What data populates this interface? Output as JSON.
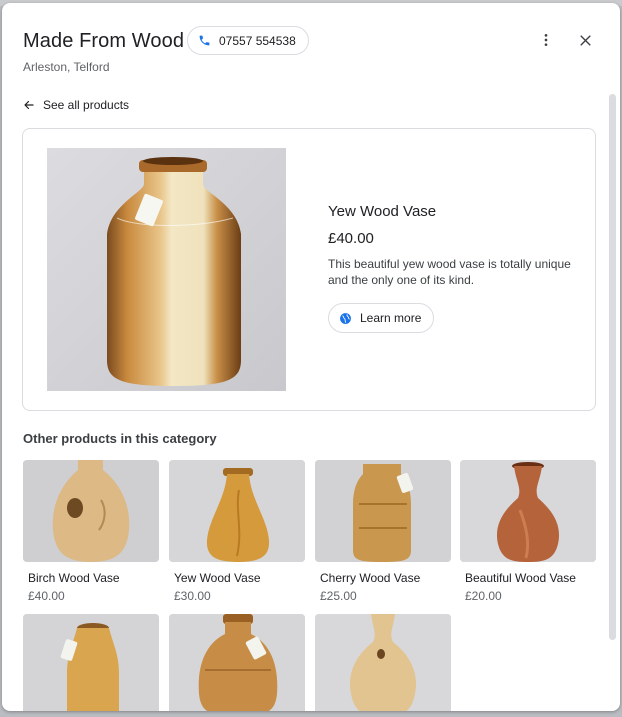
{
  "header": {
    "title": "Made From Wood",
    "phone": "07557 554538",
    "address": "Arleston, Telford",
    "phone_icon": "phone-icon",
    "more_icon": "more-vert-icon",
    "close_icon": "close-icon"
  },
  "nav": {
    "back_label": "See all products",
    "back_icon": "arrow-back-icon"
  },
  "product": {
    "name": "Yew Wood Vase",
    "price": "£40.00",
    "description": "This beautiful yew wood vase is totally unique and the only one of its kind.",
    "learn_more_label": "Learn more",
    "learn_more_icon": "globe-icon"
  },
  "other_products": {
    "heading": "Other products in this category",
    "items": [
      {
        "name": "Birch Wood Vase",
        "price": "£40.00"
      },
      {
        "name": "Yew Wood Vase",
        "price": "£30.00"
      },
      {
        "name": "Cherry Wood Vase",
        "price": "£25.00"
      },
      {
        "name": "Beautiful Wood Vase",
        "price": "£20.00"
      }
    ]
  },
  "colors": {
    "accent_blue": "#1a73e8",
    "text_primary": "#202124",
    "text_secondary": "#5f6368",
    "border": "#dadce0"
  }
}
